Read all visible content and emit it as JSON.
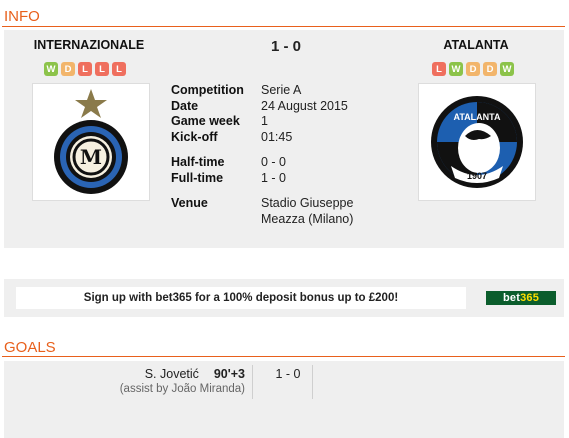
{
  "info_section": {
    "title": "INFO"
  },
  "match": {
    "home": {
      "name": "INTERNAZIONALE",
      "form": [
        "W",
        "D",
        "L",
        "L",
        "L"
      ]
    },
    "away": {
      "name": "ATALANTA",
      "form": [
        "L",
        "W",
        "D",
        "D",
        "W"
      ]
    },
    "score": "1 - 0",
    "details": [
      {
        "label": "Competition",
        "value": "Serie A"
      },
      {
        "label": "Date",
        "value": "24 August 2015"
      },
      {
        "label": "Game week",
        "value": "1"
      },
      {
        "label": "Kick-off",
        "value": "01:45"
      }
    ],
    "scores_detail": [
      {
        "label": "Half-time",
        "value": "0 - 0"
      },
      {
        "label": "Full-time",
        "value": "1 - 0"
      }
    ],
    "venue": {
      "label": "Venue",
      "line1": "Stadio Giuseppe",
      "line2": "Meazza (Milano)"
    },
    "away_crest": {
      "text": "ATALANTA",
      "year": "1907"
    }
  },
  "form_colors": {
    "W": "#8cc34a",
    "D": "#f2b56b",
    "L": "#ef6f5e"
  },
  "ad": {
    "text": "Sign up with bet365 for a 100% deposit bonus up to £200!",
    "logo_pre": "bet",
    "logo_post": "365"
  },
  "goals_section": {
    "title": "GOALS",
    "goals": [
      {
        "scorer": "S. Jovetić",
        "minute": "90'+3",
        "assist": "(assist by João Miranda)",
        "score": "1 - 0"
      }
    ]
  }
}
